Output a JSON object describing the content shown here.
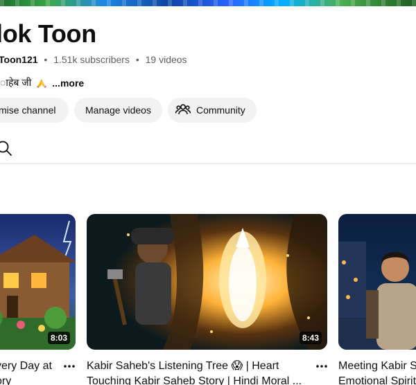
{
  "channel": {
    "name": "lok Toon",
    "handle": "Toon121",
    "subscribers": "1.51k subscribers",
    "videos": "19 videos",
    "separator": "•",
    "description": "ाहेब जी",
    "more_label": "...more"
  },
  "actions": {
    "customise": "mise channel",
    "manage": "Manage videos",
    "community": "Community"
  },
  "videos": [
    {
      "title_line1": "very Day at",
      "title_line2": "ory",
      "duration": "8:03"
    },
    {
      "title_line1": "Kabir Saheb's Listening Tree 😱 | Heart",
      "title_line2": "Touching Kabir Saheb Story | Hindi Moral ...",
      "duration": "8:43"
    },
    {
      "title_line1": "Meeting Kabir S",
      "title_line2": "Emotional Spirit",
      "duration": ""
    }
  ],
  "icons": {
    "search": "search-icon",
    "community": "people-icon",
    "more": "more-vert-icon",
    "pray": "folded-hands-icon"
  }
}
